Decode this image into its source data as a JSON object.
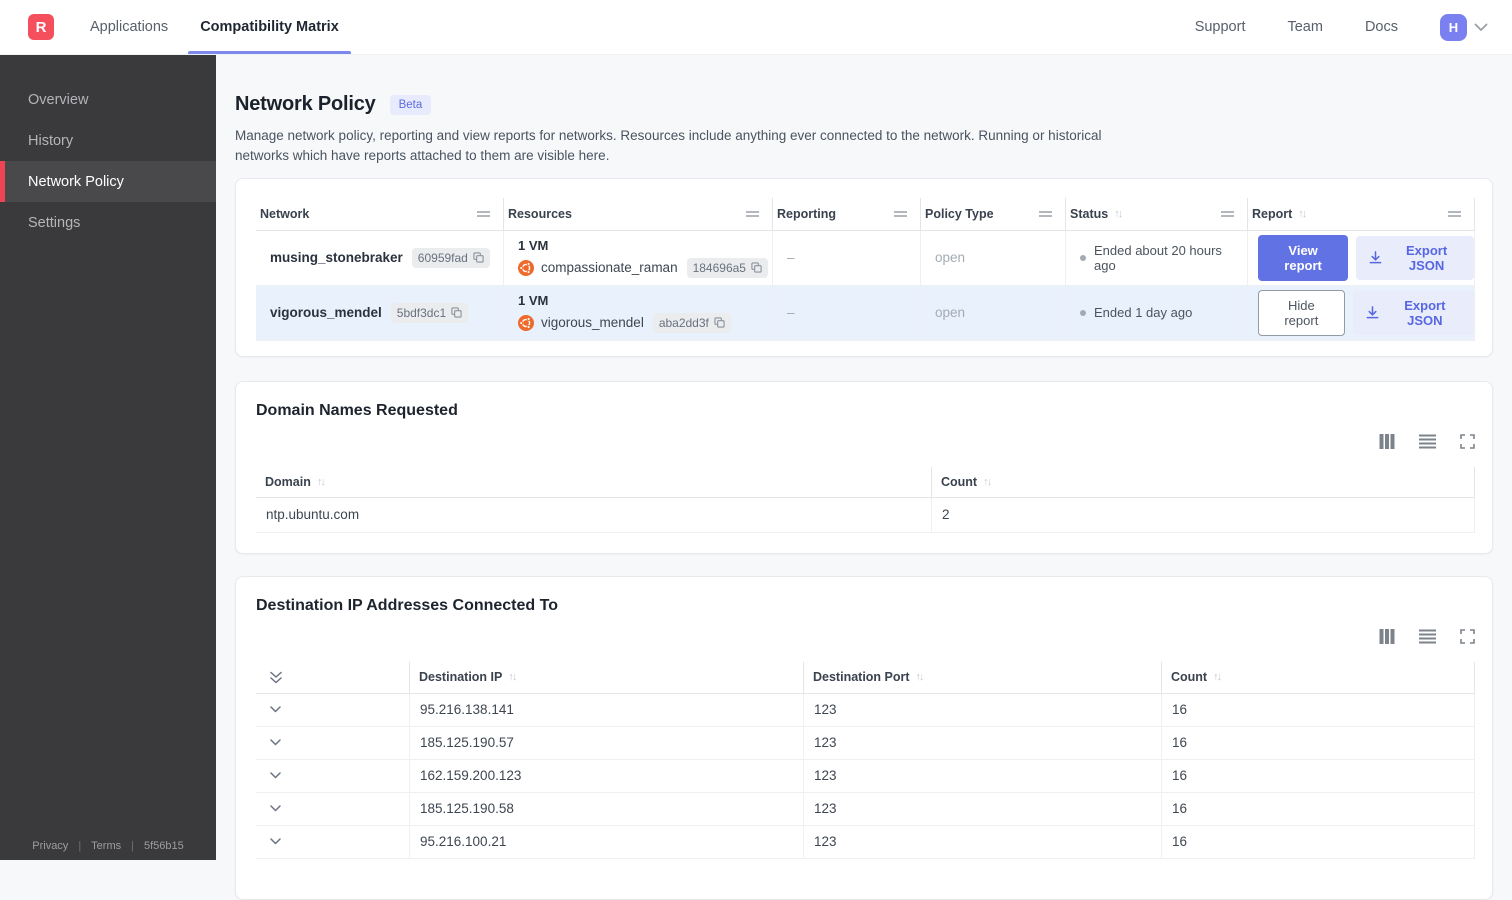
{
  "colors": {
    "brand_red": "#f54e5c",
    "accent_purple": "#6172e4",
    "accent_light": "#e8ecfb",
    "row_highlight": "#e9f1fc",
    "sidebar_active_bar": "#ee4454",
    "resource_icon_orange": "#ed6a2c"
  },
  "icons": {
    "sort_glyph": "↑↓"
  },
  "nav": {
    "logo_letter": "R",
    "tabs": [
      {
        "label": "Applications",
        "active": false
      },
      {
        "label": "Compatibility Matrix",
        "active": true
      }
    ],
    "links": [
      "Support",
      "Team",
      "Docs"
    ],
    "avatar_letter": "H"
  },
  "sidebar": {
    "items": [
      {
        "label": "Overview",
        "active": false
      },
      {
        "label": "History",
        "active": false
      },
      {
        "label": "Network Policy",
        "active": true
      },
      {
        "label": "Settings",
        "active": false
      }
    ],
    "footer": {
      "privacy": "Privacy",
      "terms": "Terms",
      "version": "5f56b15"
    }
  },
  "page": {
    "title": "Network Policy",
    "beta_badge": "Beta",
    "description": "Manage network policy, reporting and view reports for networks. Resources include anything ever connected to the network. Running or historical networks which have reports attached to them are visible here."
  },
  "network_table": {
    "columns": [
      {
        "label": "Network",
        "sortable": false
      },
      {
        "label": "Resources",
        "sortable": false
      },
      {
        "label": "Reporting",
        "sortable": false
      },
      {
        "label": "Policy Type",
        "sortable": false
      },
      {
        "label": "Status",
        "sortable": true
      },
      {
        "label": "Report",
        "sortable": true
      }
    ],
    "rows": [
      {
        "name": "musing_stonebraker",
        "hash": "60959fad",
        "vm_count": "1 VM",
        "resource_name": "compassionate_raman",
        "resource_hash": "184696a5",
        "reporting": "–",
        "policy_type": "open",
        "status": "Ended about 20 hours ago",
        "report_button": "View report",
        "export_button": "Export JSON",
        "highlighted": false
      },
      {
        "name": "vigorous_mendel",
        "hash": "5bdf3dc1",
        "vm_count": "1 VM",
        "resource_name": "vigorous_mendel",
        "resource_hash": "aba2dd3f",
        "reporting": "–",
        "policy_type": "open",
        "status": "Ended 1 day ago",
        "report_button": "Hide report",
        "export_button": "Export JSON",
        "highlighted": true
      }
    ]
  },
  "domains_card": {
    "title": "Domain Names Requested",
    "columns": [
      {
        "label": "Domain",
        "sortable": true
      },
      {
        "label": "Count",
        "sortable": true
      }
    ],
    "rows": [
      [
        "ntp.ubuntu.com",
        "2"
      ]
    ]
  },
  "destinations_card": {
    "title": "Destination IP Addresses Connected To",
    "columns": [
      {
        "label": "Destination IP",
        "sortable": true
      },
      {
        "label": "Destination Port",
        "sortable": true
      },
      {
        "label": "Count",
        "sortable": true
      }
    ],
    "rows": [
      [
        "95.216.138.141",
        "123",
        "16"
      ],
      [
        "185.125.190.57",
        "123",
        "16"
      ],
      [
        "162.159.200.123",
        "123",
        "16"
      ],
      [
        "185.125.190.58",
        "123",
        "16"
      ],
      [
        "95.216.100.21",
        "123",
        "16"
      ]
    ]
  }
}
